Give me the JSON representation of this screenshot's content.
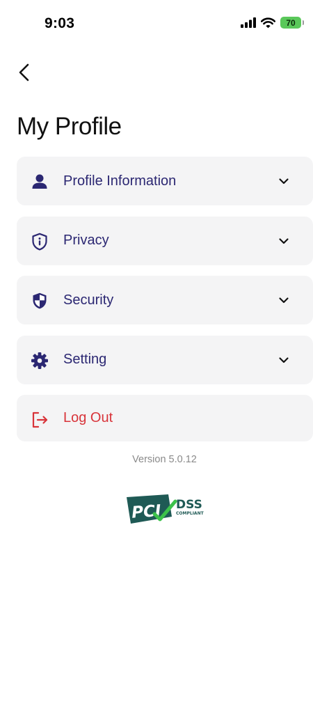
{
  "status_bar": {
    "time": "9:03",
    "battery_level": "70",
    "icons": [
      "cellular-signal-icon",
      "wifi-icon",
      "battery-icon"
    ]
  },
  "header": {
    "back_icon": "chevron-left-icon",
    "title": "My Profile"
  },
  "menu": {
    "items": [
      {
        "label": "Profile Information",
        "icon": "person-icon"
      },
      {
        "label": "Privacy",
        "icon": "shield-info-icon"
      },
      {
        "label": "Security",
        "icon": "shield-half-icon"
      },
      {
        "label": "Setting",
        "icon": "gear-icon"
      }
    ],
    "expand_icon": "chevron-down-icon",
    "logout": {
      "label": "Log Out",
      "icon": "logout-icon"
    }
  },
  "footer": {
    "version": "Version 5.0.12",
    "logo_text": {
      "pci": "PCI",
      "dss": "DSS",
      "compliant": "COMPLIANT"
    }
  },
  "colors": {
    "accent": "#2b2772",
    "danger": "#d8343a",
    "card_bg": "#f4f4f5",
    "pci_green": "#1f5a55"
  }
}
